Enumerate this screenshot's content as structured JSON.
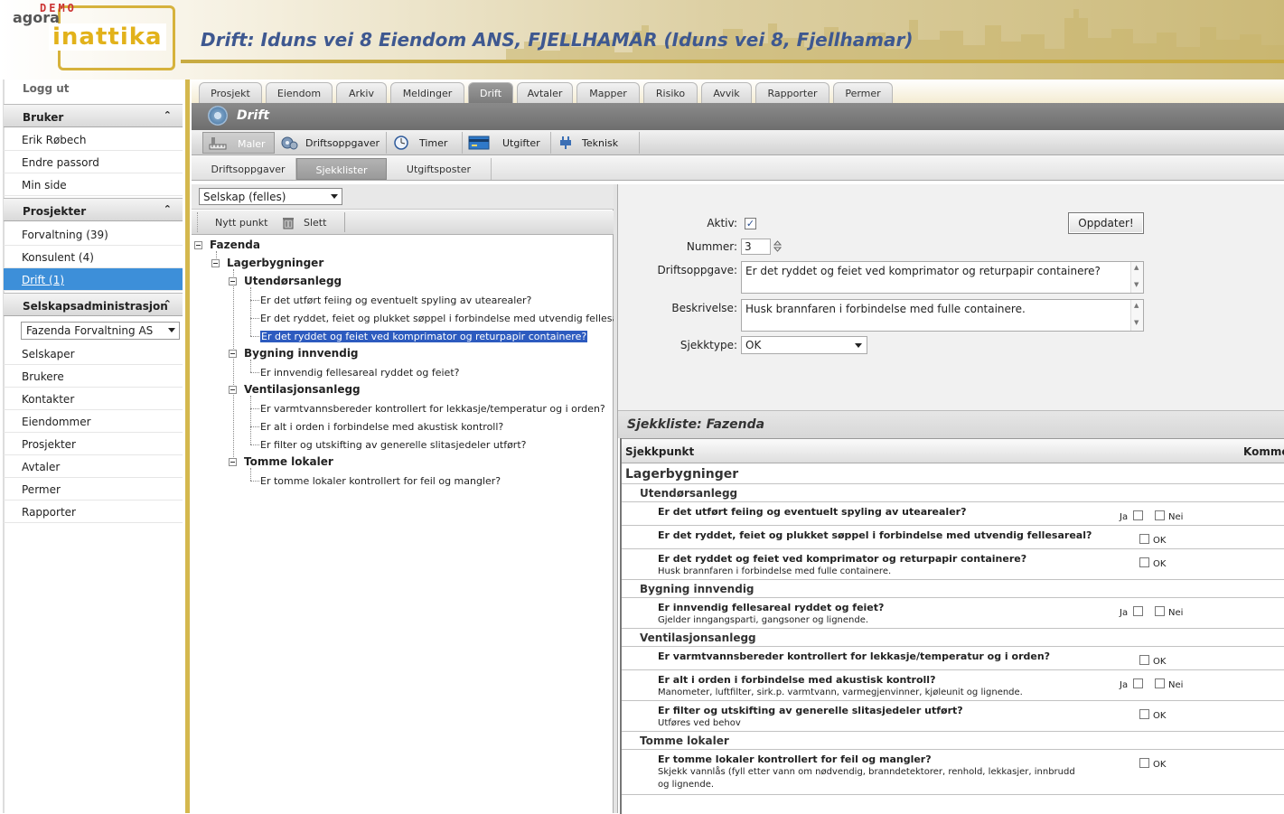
{
  "header": {
    "logo_demo": "DEMO",
    "logo_agora": "agora",
    "logo_brand": "inattika",
    "title": "Drift: Iduns vei 8 Eiendom ANS, FJELLHAMAR (Iduns vei 8, Fjellhamar)"
  },
  "sidebar": {
    "logout": "Logg ut",
    "user_section": "Bruker",
    "user_items": [
      "Erik Røbech",
      "Endre passord",
      "Min side"
    ],
    "projects_section": "Prosjekter",
    "project_items": [
      "Forvaltning (39)",
      "Konsulent (4)",
      "Drift (1)"
    ],
    "admin_section": "Selskapsadministrasjon",
    "company_select": "Fazenda Forvaltning AS",
    "admin_items": [
      "Selskaper",
      "Brukere",
      "Kontakter",
      "Eiendommer",
      "Prosjekter",
      "Avtaler",
      "Permer",
      "Rapporter"
    ],
    "collapse_glyph": "⌃"
  },
  "tabs": [
    "Prosjekt",
    "Eiendom",
    "Arkiv",
    "Meldinger",
    "Drift",
    "Avtaler",
    "Mapper",
    "Risiko",
    "Avvik",
    "Rapporter",
    "Permer"
  ],
  "section_title": "Drift",
  "toolbar": [
    "Maler",
    "Driftsoppgaver",
    "Timer",
    "Utgifter",
    "Teknisk"
  ],
  "subtabs": [
    "Driftsoppgaver",
    "Sjekklister",
    "Utgiftsposter"
  ],
  "left": {
    "company_filter": "Selskap (felles)",
    "new_point": "Nytt punkt",
    "delete": "Slett",
    "tree": [
      "Fazenda",
      "Lagerbygninger",
      "Utendørsanlegg",
      "Er det utført feiing og eventuelt spyling av utearealer?",
      "Er det ryddet, feiet og plukket søppel i forbindelse med utvendig fellesareal?",
      "Er det ryddet og feiet ved komprimator og returpapir containere?",
      "Bygning innvendig",
      "Er innvendig fellesareal ryddet og feiet?",
      "Ventilasjonsanlegg",
      "Er varmtvannsbereder kontrollert for lekkasje/temperatur og i orden?",
      "Er alt i orden i forbindelse med akustisk kontroll?",
      "Er filter og utskifting av generelle slitasjedeler utført?",
      "Tomme lokaler",
      "Er tomme lokaler kontrollert for feil og mangler?"
    ]
  },
  "form": {
    "aktiv_label": "Aktiv:",
    "aktiv_check": "✓",
    "update_button": "Oppdater!",
    "nummer_label": "Nummer:",
    "nummer_value": "3",
    "driftsoppgave_label": "Driftsoppgave:",
    "driftsoppgave_value": "Er det ryddet og feiet ved komprimator og returpapir containere?",
    "beskrivelse_label": "Beskrivelse:",
    "beskrivelse_value": "Husk brannfaren i forbindelse med fulle containere.",
    "sjekktype_label": "Sjekktype:",
    "sjekktype_value": "OK"
  },
  "checklist": {
    "title": "Sjekkliste: Fazenda",
    "col_point": "Sjekkpunkt",
    "col_comment": "Komme",
    "group": "Lagerbygninger",
    "ja": "Ja",
    "nei": "Nei",
    "ok": "OK",
    "rows": [
      {
        "cat": "Utendørsanlegg"
      },
      {
        "q": "Er det utført feiing og eventuelt spyling av utearealer?",
        "d": "",
        "t": "janei"
      },
      {
        "q": "Er det ryddet, feiet og plukket søppel i forbindelse med utvendig fellesareal?",
        "d": "",
        "t": "ok"
      },
      {
        "q": "Er det ryddet og feiet ved komprimator og returpapir containere?",
        "d": "Husk brannfaren i forbindelse med fulle containere.",
        "t": "ok"
      },
      {
        "cat": "Bygning innvendig"
      },
      {
        "q": "Er innvendig fellesareal ryddet og feiet?",
        "d": "Gjelder inngangsparti, gangsoner og lignende.",
        "t": "janei"
      },
      {
        "cat": "Ventilasjonsanlegg"
      },
      {
        "q": "Er varmtvannsbereder kontrollert for lekkasje/temperatur og i orden?",
        "d": "",
        "t": "ok"
      },
      {
        "q": "Er alt i orden i forbindelse med akustisk kontroll?",
        "d": "Manometer, luftfilter, sirk.p. varmtvann, varmegjenvinner, kjøleunit og lignende.",
        "t": "janei"
      },
      {
        "q": "Er filter og utskifting av generelle slitasjedeler utført?",
        "d": "Utføres ved behov",
        "t": "ok"
      },
      {
        "cat": "Tomme lokaler"
      },
      {
        "q": "Er tomme lokaler kontrollert for feil og mangler?",
        "d": "Skjekk vannlås (fyll etter vann om nødvendig, branndetektorer, renhold, lekkasjer, innbrudd",
        "d2": "og lignende.",
        "t": "ok"
      }
    ]
  },
  "colors": {
    "accent_gold": "#d4b84e",
    "title_blue": "#3e5890",
    "selection_blue": "#2d5bbf",
    "sidebar_active": "#3d8fd9"
  },
  "icons": [
    "gear-icon",
    "ruler-icon",
    "timer-icon",
    "card-icon",
    "plug-icon",
    "trash-icon",
    "tree-toggle-icon",
    "spinner-icon",
    "dropdown-arrow-icon"
  ]
}
